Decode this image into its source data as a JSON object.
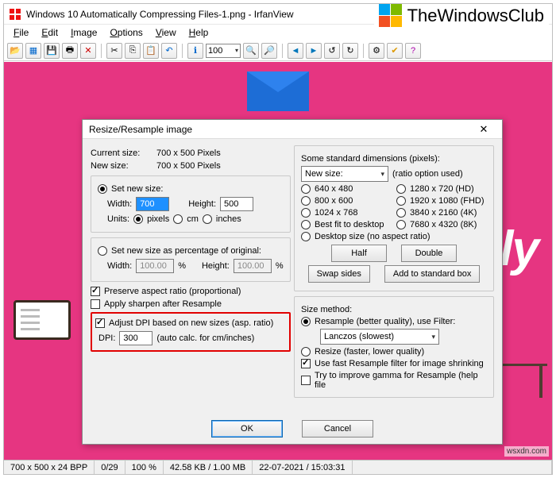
{
  "window": {
    "title": "Windows 10 Automatically Compressing Files-1.png - IrfanView",
    "min": "—",
    "max": "▢",
    "close": "✕"
  },
  "brand": "TheWindowsClub",
  "menu": [
    "File",
    "Edit",
    "Image",
    "Options",
    "View",
    "Help"
  ],
  "toolbar": {
    "zoom": "100"
  },
  "bgword": "lly",
  "dialog": {
    "title": "Resize/Resample image",
    "close": "✕",
    "cur_label": "Current size:",
    "cur_val": "700  x  500  Pixels",
    "new_label": "New size:",
    "new_val": "700  x  500  Pixels",
    "setnew": "Set new size:",
    "width_l": "Width:",
    "width_v": "700",
    "height_l": "Height:",
    "height_v": "500",
    "units_l": "Units:",
    "u_px": "pixels",
    "u_cm": "cm",
    "u_in": "inches",
    "pct_radio": "Set new size as percentage of original:",
    "pct_w_l": "Width:",
    "pct_w_v": "100.00",
    "pct_h_l": "Height:",
    "pct_h_v": "100.00",
    "pct": "%",
    "preserve": "Preserve aspect ratio (proportional)",
    "sharpen": "Apply sharpen after Resample",
    "adjustdpi": "Adjust DPI based on new sizes (asp. ratio)",
    "dpi_l": "DPI:",
    "dpi_v": "300",
    "dpi_note": "(auto calc. for cm/inches)",
    "std_title": "Some standard dimensions (pixels):",
    "std_dd": "New size:",
    "std_note": "(ratio option used)",
    "d1": "640 x 480",
    "d2": "1280 x 720   (HD)",
    "d3": "800 x 600",
    "d4": "1920 x 1080 (FHD)",
    "d5": "1024 x 768",
    "d6": "3840 x 2160 (4K)",
    "d7": "Best fit to desktop",
    "d8": "7680 x 4320 (8K)",
    "d9": "Desktop size (no aspect ratio)",
    "b_half": "Half",
    "b_double": "Double",
    "b_swap": "Swap sides",
    "b_add": "Add to standard box",
    "method_t": "Size method:",
    "resample": "Resample (better quality), use Filter:",
    "filter": "Lanczos (slowest)",
    "resize": "Resize (faster, lower quality)",
    "fast": "Use fast Resample filter for image shrinking",
    "gamma": "Try to improve gamma for Resample (help file",
    "ok": "OK",
    "cancel": "Cancel"
  },
  "status": {
    "s1": "700 x 500 x 24 BPP",
    "s2": "0/29",
    "s3": "100 %",
    "s4": "42.58 KB / 1.00 MB",
    "s5": "22-07-2021 / 15:03:31"
  },
  "watermark": "wsxdn.com"
}
